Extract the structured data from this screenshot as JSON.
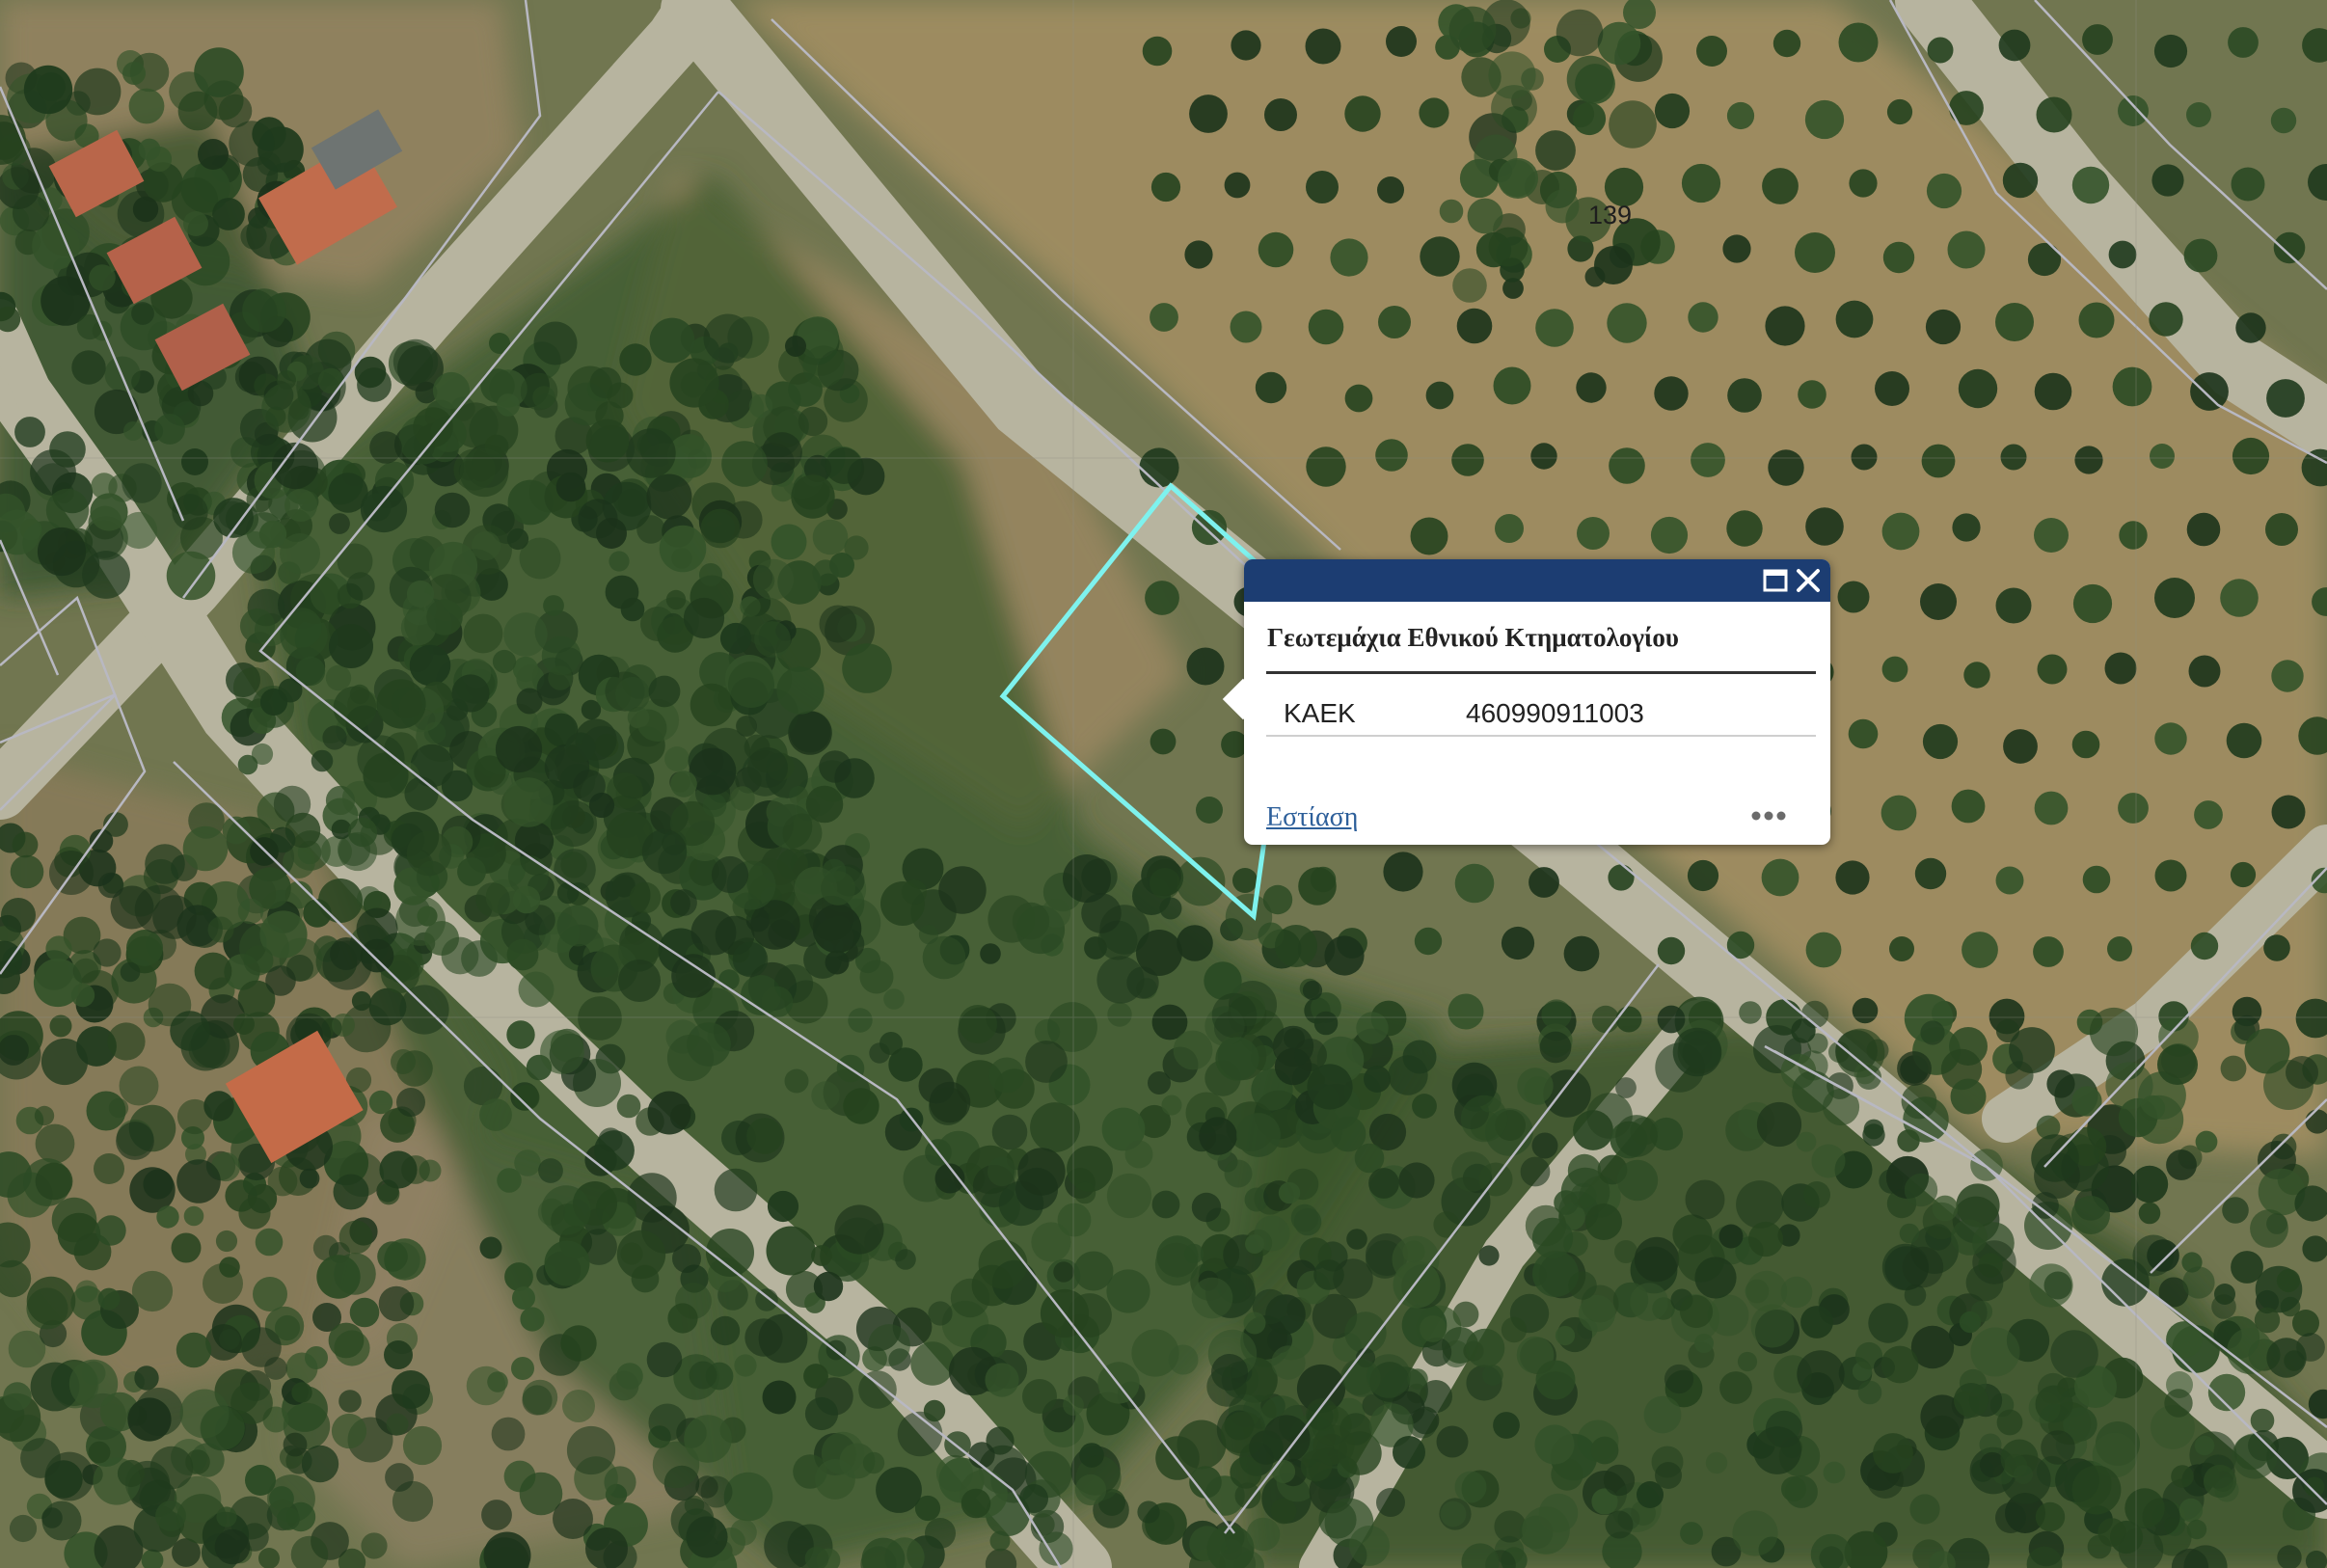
{
  "map": {
    "parcel_number": "139",
    "colors": {
      "parcel_lines": "#b8b8c2",
      "selected_parcel": "#7ef2ee",
      "road": "#b4b19a",
      "vegetation": "#2f4a26",
      "soil": "#a08a62",
      "roof": "#b5624a"
    }
  },
  "popup": {
    "title": "Γεωτεμάχια Εθνικού Κτηματολογίου",
    "maximize_icon": "maximize-icon",
    "close_icon": "close-icon",
    "attributes": [
      {
        "key": "KAEK",
        "value": "460990911003"
      }
    ],
    "zoom_link": "Εστίαση",
    "more_icon": "more-icon",
    "colors": {
      "header": "#1c3d72",
      "link": "#2d5f9a"
    }
  }
}
